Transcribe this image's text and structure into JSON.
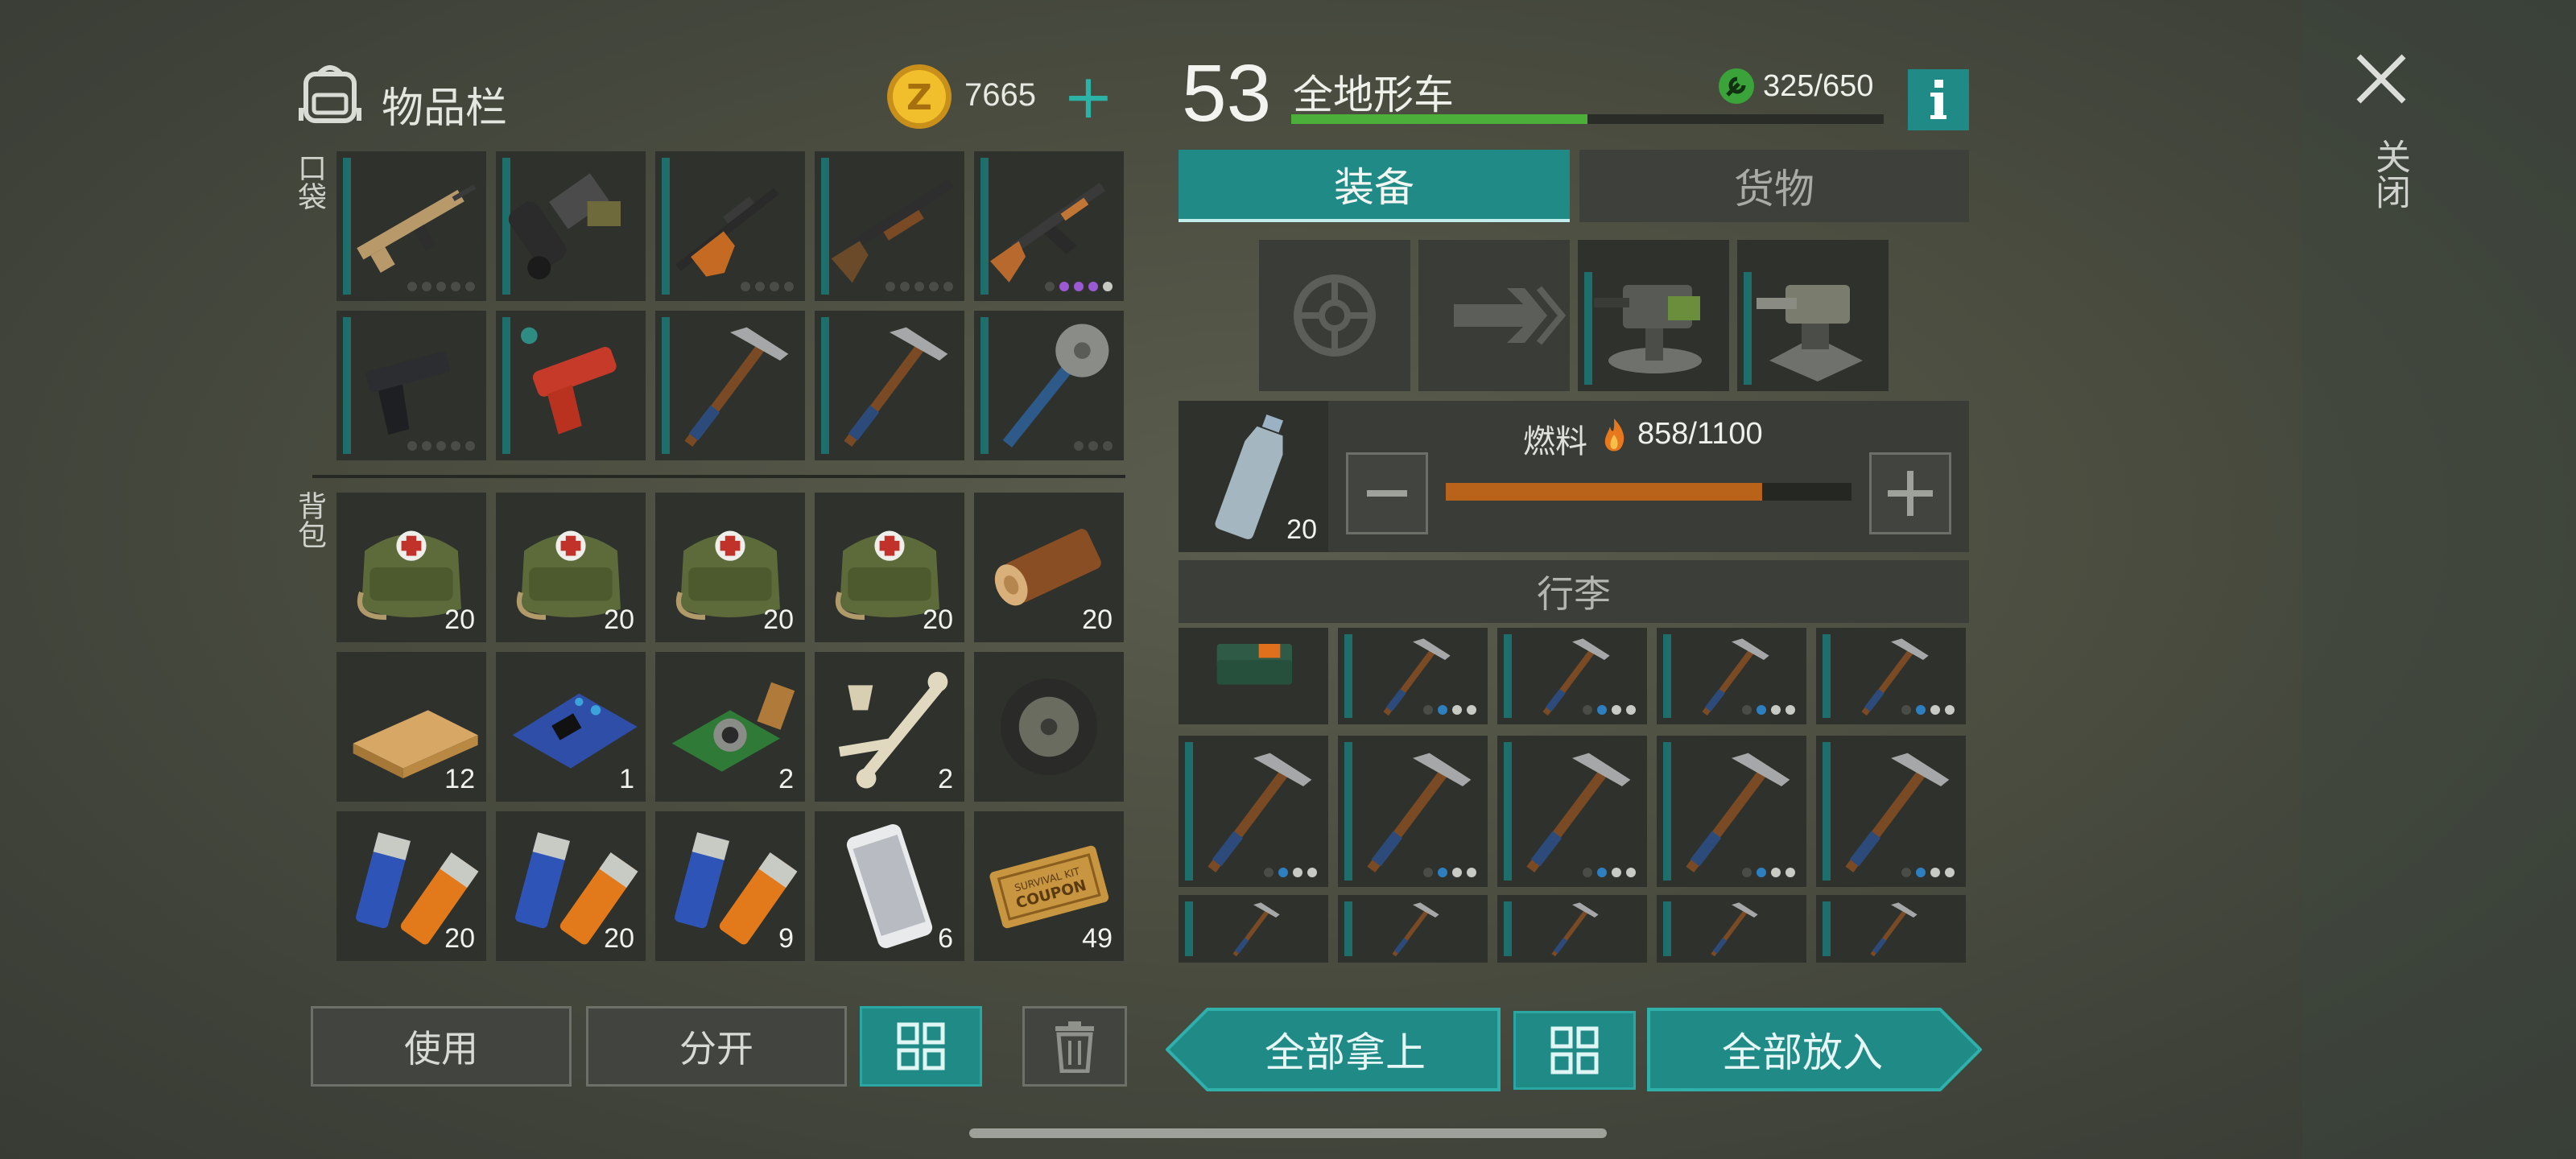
{
  "inventory": {
    "title": "物品栏",
    "coins": "7665",
    "pocket_label": "口袋",
    "backpack_label": "背包",
    "pockets": [
      {
        "name": "assault-rifle-icon",
        "dots": [
          "d",
          "d",
          "d",
          "d",
          "d"
        ]
      },
      {
        "name": "grenade-launcher-icon",
        "dots": []
      },
      {
        "name": "hunting-rifle-icon",
        "dots": [
          "d",
          "d",
          "d",
          "d"
        ]
      },
      {
        "name": "shotgun-icon",
        "dots": [
          "d",
          "d",
          "d",
          "d",
          "d"
        ]
      },
      {
        "name": "ak-rifle-icon",
        "dots": [
          "d",
          "p",
          "p",
          "p",
          "g"
        ]
      },
      {
        "name": "pistol-icon",
        "dots": [
          "d",
          "d",
          "d",
          "d",
          "d"
        ]
      },
      {
        "name": "flare-gun-icon",
        "dots": []
      },
      {
        "name": "pickaxe-icon",
        "dots": []
      },
      {
        "name": "pickaxe-icon",
        "dots": []
      },
      {
        "name": "sawblade-mace-icon",
        "dots": [
          "d",
          "d",
          "d"
        ]
      }
    ],
    "backpack": [
      {
        "name": "medkit-bag-icon",
        "count": "20"
      },
      {
        "name": "medkit-bag-icon",
        "count": "20"
      },
      {
        "name": "medkit-bag-icon",
        "count": "20"
      },
      {
        "name": "medkit-bag-icon",
        "count": "20"
      },
      {
        "name": "log-icon",
        "count": "20"
      },
      {
        "name": "plank-icon",
        "count": "12"
      },
      {
        "name": "circuit-board-icon",
        "count": "1"
      },
      {
        "name": "camera-module-icon",
        "count": "2"
      },
      {
        "name": "bones-icon",
        "count": "2"
      },
      {
        "name": "wheel-icon",
        "count": ""
      },
      {
        "name": "battery-icon",
        "count": "20"
      },
      {
        "name": "battery-icon",
        "count": "20"
      },
      {
        "name": "battery-icon",
        "count": "9"
      },
      {
        "name": "smartphone-icon",
        "count": "6"
      },
      {
        "name": "coupon-icon",
        "count": "49"
      }
    ],
    "buttons": {
      "use": "使用",
      "split": "分开"
    }
  },
  "vehicle": {
    "level": "53",
    "name": "全地形车",
    "durability": "325/650",
    "durability_fraction": 0.5,
    "tabs": [
      "装备",
      "货物"
    ],
    "fuel_label": "燃料",
    "fuel_value": "858/1100",
    "fuel_fraction": 0.78,
    "bottle_count": "20",
    "luggage_label": "行李",
    "take_all": "全部拿上",
    "put_all": "全部放入"
  },
  "close_label": "关闭",
  "colors": {
    "teal": "#1f8a86",
    "fuel": "#b8621a",
    "durability": "#4caf3a",
    "accent_purple": "#9b59d4"
  }
}
